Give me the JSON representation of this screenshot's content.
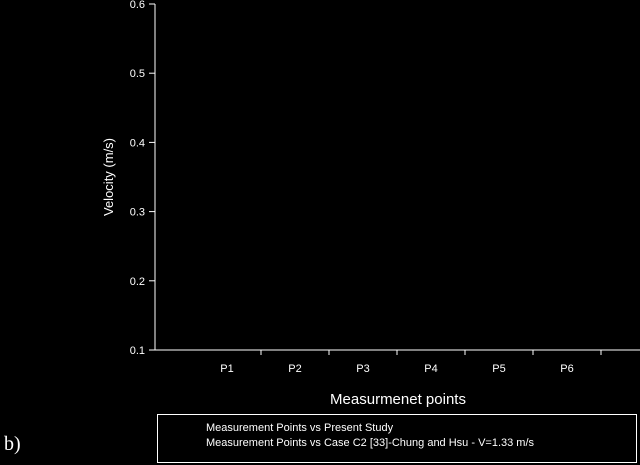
{
  "chart_data": {
    "type": "scatter",
    "panel_label": "b)",
    "title": "",
    "xlabel": "Measurmenet points",
    "ylabel": "Velocity (m/s)",
    "categories": [
      "P1",
      "P2",
      "P3",
      "P4",
      "P5",
      "P6"
    ],
    "yticks": [
      "0.1",
      "0.2",
      "0.3",
      "0.4",
      "0.5",
      "0.6"
    ],
    "ylim": [
      0.1,
      0.6
    ],
    "grid": false,
    "legend_position": "bottom",
    "series": [
      {
        "name": "Measurement Points vs Present Study",
        "values": []
      },
      {
        "name": "Measurement Points vs Case C2 [33]-Chung and Hsu - V=1.33 m/s",
        "values": []
      }
    ],
    "colors": {
      "background": "#000000",
      "axis": "#ffffff",
      "text": "#ffffff"
    }
  }
}
